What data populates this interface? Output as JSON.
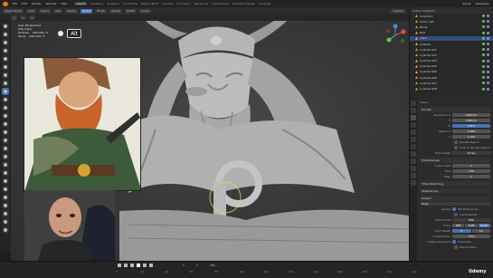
{
  "topmenu": {
    "menus": [
      "File",
      "Edit",
      "Render",
      "Window",
      "Help"
    ],
    "tabs": [
      "Layout",
      "Modeling",
      "Sculpting",
      "UV Editing",
      "Texture Paint",
      "Shading",
      "Animation",
      "Rendering",
      "Compositing",
      "Geometry Nodes",
      "Scripting"
    ],
    "active_tab": "Layout",
    "scene_label": "Scene",
    "view_layer_label": "ViewLayer"
  },
  "header": {
    "mode": "Object Mode",
    "view": "View",
    "select": "Select",
    "add": "Add",
    "object": "Object",
    "transform": "Global",
    "brush": "Brush",
    "stroke": "Stroke",
    "falloff": "Falloff",
    "cursor": "Cursor",
    "options": "Options"
  },
  "viewport_overlay": {
    "view_name": "User Perspective",
    "collection": "(30) Cape",
    "vertices_label": "Vertices",
    "vertices_value": "200,346 / 0",
    "faces_label": "Faces",
    "faces_value": "200,164 / 0",
    "key_hint": "Alt"
  },
  "outliner": {
    "title": "Scene Collection",
    "items": [
      {
        "label": "Collection",
        "selected": false
      },
      {
        "label": "Armor_left",
        "selected": false
      },
      {
        "label": "Boots",
        "selected": false
      },
      {
        "label": "Belt",
        "selected": false
      },
      {
        "label": "Cape",
        "selected": true
      },
      {
        "label": "Cylinder",
        "selected": false
      },
      {
        "label": "Cylinder.001",
        "selected": false
      },
      {
        "label": "Cylinder.002",
        "selected": false
      },
      {
        "label": "Cylinder.003",
        "selected": false
      },
      {
        "label": "Cylinder.004",
        "selected": false
      },
      {
        "label": "Cylinder.005",
        "selected": false
      },
      {
        "label": "Cylinder.006",
        "selected": false
      },
      {
        "label": "Cylinder.007",
        "selected": false
      },
      {
        "label": "Cylinder.008",
        "selected": false
      }
    ]
  },
  "properties": {
    "context": "Scene",
    "format_section": "Format",
    "res_x_label": "Resolution X",
    "res_x": "1920 px",
    "res_y_label": "Y",
    "res_y": "1080 px",
    "res_pct_label": "%",
    "res_pct": "100%",
    "aspect_x_label": "Aspect X",
    "aspect_x": "1.000",
    "aspect_y_label": "Y",
    "aspect_y": "1.000",
    "render_region": "Render Region",
    "crop_label": "Crop to Render Region",
    "frame_rate_label": "Frame Rate",
    "frame_rate": "24 fps",
    "frame_range_section": "Frame Range",
    "frame_start_label": "Frame Start",
    "frame_start": "1",
    "frame_end_label": "End",
    "frame_end": "250",
    "frame_step_label": "Step",
    "frame_step": "1",
    "time_stretching": "Time Stretching",
    "stereoscopy": "Stereoscopy",
    "output_section": "Output",
    "output_path": "/tmp\\",
    "saving_label": "Saving",
    "file_extensions": "File Extensions",
    "cache_result": "Cache Result",
    "file_format_label": "File Format",
    "file_format": "PNG",
    "color_label": "Color",
    "color_options": [
      "BW",
      "RGB",
      "RGBA"
    ],
    "color_active": "RGBA",
    "color_depth_label": "Color Depth",
    "depth_options": [
      "8",
      "16"
    ],
    "compression_label": "Compression",
    "compression": "15%",
    "image_sequence_label": "Image Sequence",
    "overwrite": "Overwrite",
    "placeholders": "Placeholders"
  },
  "timeline": {
    "ticks": [
      "0",
      "20",
      "40",
      "60",
      "80",
      "100",
      "120",
      "140",
      "160",
      "180",
      "200",
      "220",
      "240"
    ],
    "current_frame": "1",
    "start": "1",
    "end": "250"
  },
  "watermark": "Udemy",
  "colors": {
    "accent": "#4772b3",
    "selected_row": "#334d80",
    "orange": "#e87d0d",
    "background": "#1d1d1d"
  }
}
